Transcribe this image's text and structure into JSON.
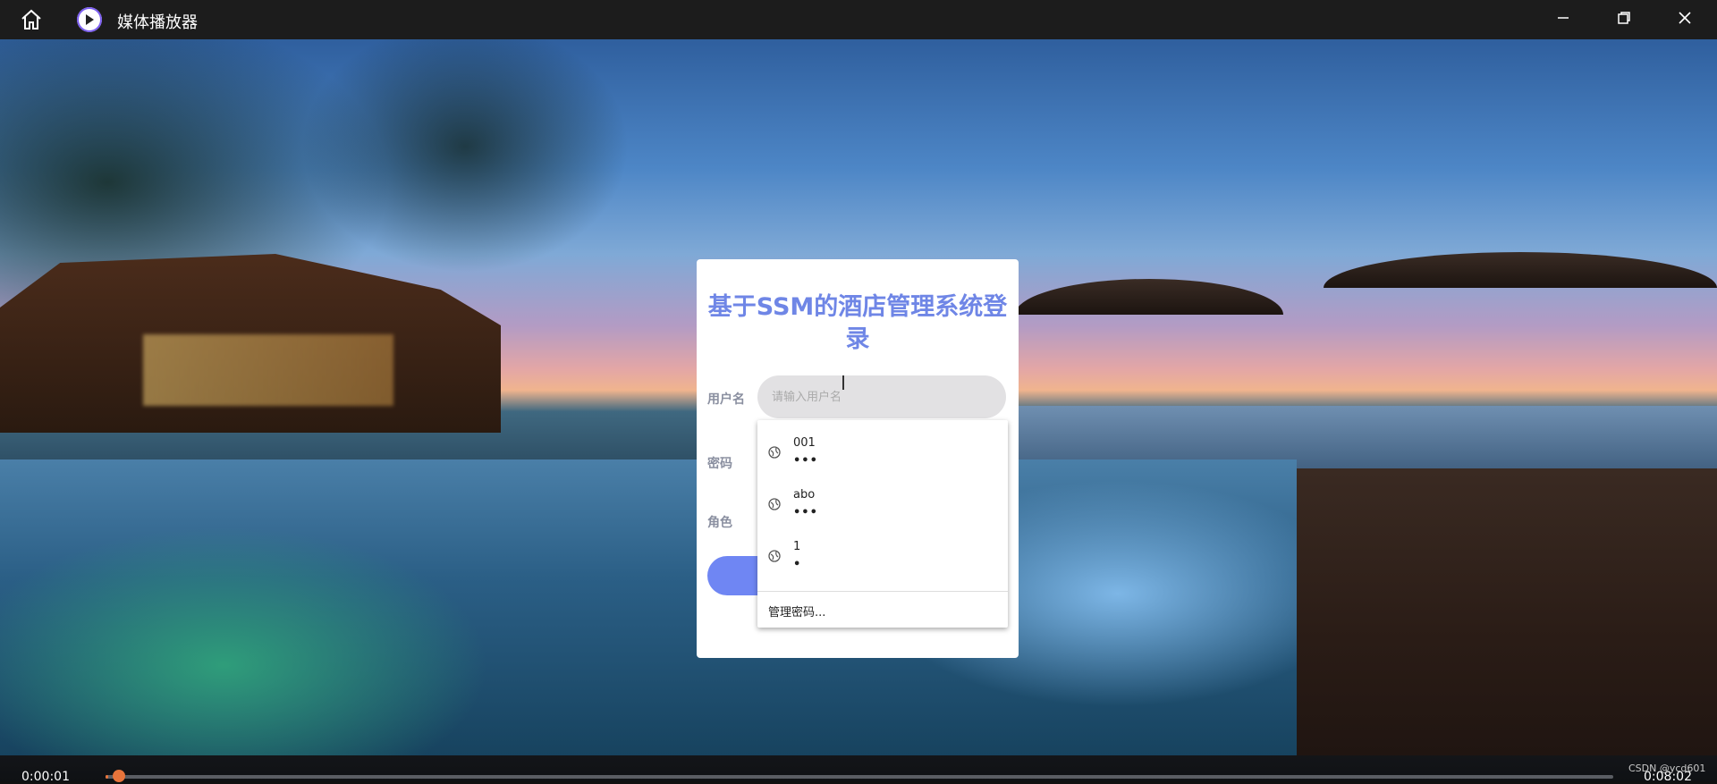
{
  "app": {
    "title": "媒体播放器"
  },
  "window_controls": {
    "home": "home-icon",
    "minimize": "minimize-icon",
    "maximize": "restore-icon",
    "close": "close-icon"
  },
  "login": {
    "title": "基于SSM的酒店管理系统登录",
    "username_label": "用户名",
    "username_placeholder": "请输入用户名",
    "password_label": "密码",
    "role_label": "角色"
  },
  "autocomplete": {
    "items": [
      {
        "username": "001",
        "password_mask": "•••"
      },
      {
        "username": "abo",
        "password_mask": "•••"
      },
      {
        "username": "1",
        "password_mask": "•"
      }
    ],
    "manage_label": "管理密码..."
  },
  "player": {
    "elapsed": "0:00:01",
    "remaining": "0:08:02",
    "progress": 0.002,
    "accent_color": "#e8743b"
  },
  "watermark": "CSDN @ycd601"
}
